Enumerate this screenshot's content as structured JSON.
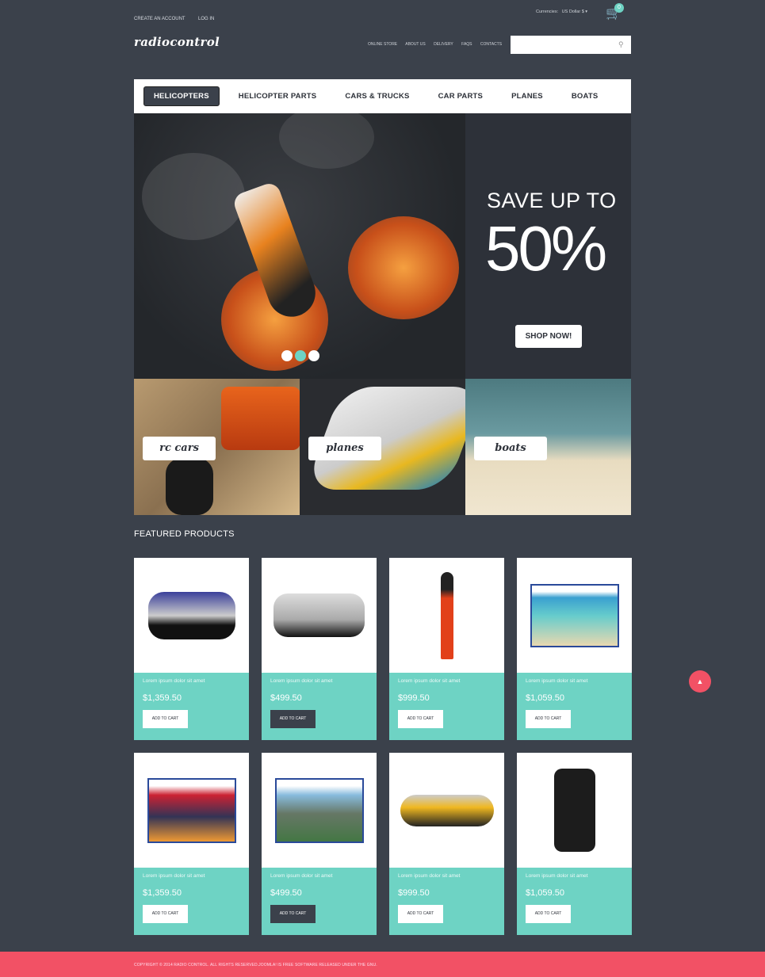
{
  "topbar": {
    "create_account": "CREATE AN ACCOUNT",
    "login": "LOG IN",
    "currencies_label": "Currencies:",
    "currency": "US Dollar $",
    "cart_count": "0"
  },
  "header": {
    "logo": "radiocontrol",
    "menu": [
      "ONLINE STORE",
      "ABOUT US",
      "DELIVERY",
      "FAQS",
      "CONTACTS"
    ],
    "search_placeholder": ""
  },
  "nav": [
    "HELICOPTERS",
    "HELICOPTER PARTS",
    "CARS & TRUCKS",
    "CAR PARTS",
    "PLANES",
    "BOATS"
  ],
  "hero": {
    "headline": "SAVE UP TO",
    "percent": "50%",
    "cta": "SHOP NOW!",
    "active_slide": 2,
    "slides": 3
  },
  "categories": [
    "rc cars",
    "planes",
    "boats"
  ],
  "featured": {
    "title": "FEATURED PRODUCTS",
    "products": [
      {
        "name": "Lorem ipsum dolor sit amet",
        "price": "$1,359.50",
        "button": "ADD TO CART",
        "img": "monster-truck",
        "dark": false
      },
      {
        "name": "Lorem ipsum dolor sit amet",
        "price": "$499.50",
        "button": "ADD TO CART",
        "img": "rc-car-remote",
        "dark": true
      },
      {
        "name": "Lorem ipsum dolor sit amet",
        "price": "$999.50",
        "button": "ADD TO CART",
        "img": "rocket",
        "dark": false
      },
      {
        "name": "Lorem ipsum dolor sit amet",
        "price": "$1,059.50",
        "button": "ADD TO CART",
        "img": "puzzle-beach",
        "dark": false
      },
      {
        "name": "Lorem ipsum dolor sit amet",
        "price": "$1,359.50",
        "button": "ADD TO CART",
        "img": "puzzle-city",
        "dark": false
      },
      {
        "name": "Lorem ipsum dolor sit amet",
        "price": "$499.50",
        "button": "ADD TO CART",
        "img": "puzzle-mountain",
        "dark": true
      },
      {
        "name": "Lorem ipsum dolor sit amet",
        "price": "$999.50",
        "button": "ADD TO CART",
        "img": "helicopter",
        "dark": false
      },
      {
        "name": "Lorem ipsum dolor sit amet",
        "price": "$1,059.50",
        "button": "ADD TO CART",
        "img": "camera-logger",
        "dark": false
      }
    ]
  },
  "footer": {
    "copyright": "COPYRIGHT © 2014 RADIO CONTROL. ALL RIGHTS RESERVED.JOOMLA! IS FREE SOFTWARE RELEASED UNDER THE GNU."
  },
  "colors": {
    "background": "#3b414b",
    "accent": "#6ed3c4",
    "footer": "#f25165"
  }
}
